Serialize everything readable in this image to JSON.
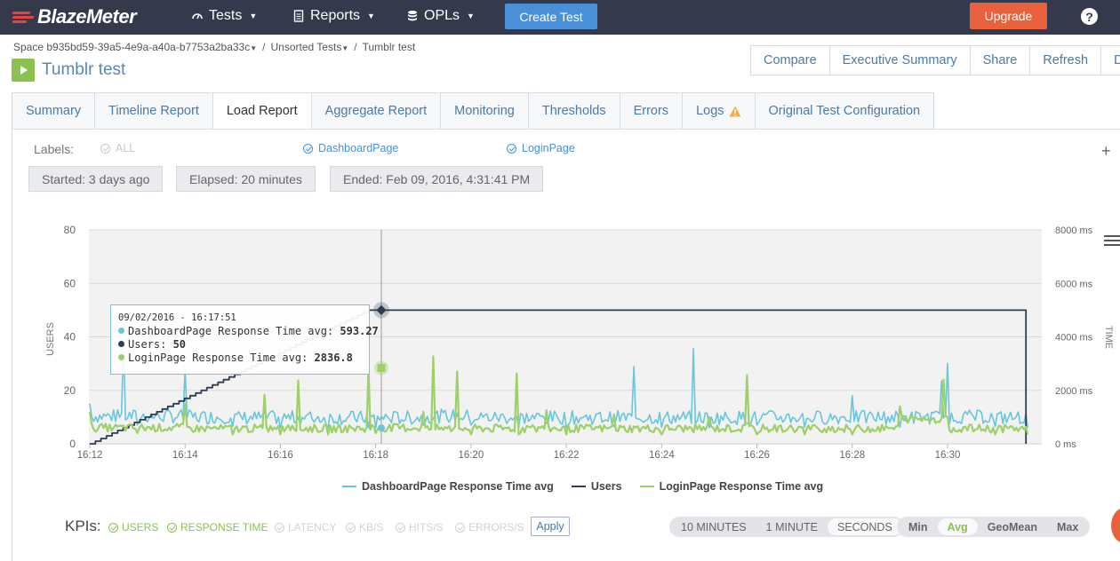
{
  "nav": {
    "brand": "BlazeMeter",
    "items": [
      {
        "label": "Tests",
        "icon": "gauge-icon"
      },
      {
        "label": "Reports",
        "icon": "document-icon"
      },
      {
        "label": "OPLs",
        "icon": "database-icon"
      }
    ],
    "create_label": "Create Test",
    "upgrade_label": "Upgrade",
    "help_label": "?"
  },
  "breadcrumb": {
    "space": "Space b935bd59-39a5-4e9a-a40a-b7753a2ba33c",
    "folder": "Unsorted Tests",
    "test": "Tumblr test",
    "separator": "/"
  },
  "page_title": "Tumblr test",
  "actions": [
    "Compare",
    "Executive Summary",
    "Share",
    "Refresh",
    "D"
  ],
  "tabs": [
    {
      "label": "Summary"
    },
    {
      "label": "Timeline Report"
    },
    {
      "label": "Load Report",
      "active": true
    },
    {
      "label": "Aggregate Report"
    },
    {
      "label": "Monitoring"
    },
    {
      "label": "Thresholds"
    },
    {
      "label": "Errors"
    },
    {
      "label": "Logs",
      "warning": true
    },
    {
      "label": "Original Test Configuration"
    }
  ],
  "labels": {
    "title": "Labels:",
    "options": [
      {
        "label": "ALL",
        "checked": false
      },
      {
        "label": "DashboardPage",
        "checked": true
      },
      {
        "label": "LoginPage",
        "checked": true
      }
    ]
  },
  "status": {
    "started": "Started: 3 days ago",
    "elapsed": "Elapsed: 20 minutes",
    "ended": "Ended: Feb 09, 2016, 4:31:41 PM"
  },
  "tooltip": {
    "timestamp": "09/02/2016 - 16:17:51",
    "rows": [
      {
        "label": "DashboardPage Response Time avg: ",
        "value": "593.27",
        "color": "#67c6dc"
      },
      {
        "label": "Users: ",
        "value": "50",
        "color": "#2d3e50"
      },
      {
        "label": "LoginPage Response Time avg: ",
        "value": "2836.8",
        "color": "#9ed068"
      }
    ]
  },
  "chart_data": {
    "type": "line",
    "x": [
      "16:12",
      "16:13",
      "16:14",
      "16:15",
      "16:16",
      "16:17",
      "16:17:51",
      "16:18",
      "16:19",
      "16:20",
      "16:21",
      "16:22",
      "16:23",
      "16:24",
      "16:25",
      "16:26",
      "16:27",
      "16:28",
      "16:29",
      "16:30",
      "16:31",
      "16:31:41"
    ],
    "x_ticks": [
      "16:12",
      "16:14",
      "16:16",
      "16:18",
      "16:20",
      "16:22",
      "16:24",
      "16:26",
      "16:28",
      "16:30"
    ],
    "y_left": {
      "label": "USERS",
      "ticks": [
        "0",
        "20",
        "40",
        "60",
        "80"
      ],
      "range": [
        0,
        80
      ]
    },
    "y_right": {
      "label": "TIME",
      "ticks": [
        "0 ms",
        "2000 ms",
        "4000 ms",
        "6000 ms",
        "8000 ms"
      ],
      "range": [
        0,
        8000
      ]
    },
    "series": [
      {
        "name": "DashboardPage Response Time avg",
        "axis": "right",
        "color": "#67c6dc",
        "values": [
          1500,
          700,
          2800,
          650,
          600,
          600,
          593.27,
          600,
          700,
          700,
          620,
          600,
          650,
          620,
          600,
          700,
          620,
          1800,
          620,
          3000,
          650,
          600
        ]
      },
      {
        "name": "Users",
        "axis": "left",
        "color": "#2d3e50",
        "values": [
          0,
          4,
          12,
          22,
          32,
          41,
          50,
          50,
          50,
          50,
          50,
          50,
          50,
          50,
          50,
          50,
          50,
          50,
          50,
          50,
          50,
          0
        ]
      },
      {
        "name": "LoginPage Response Time avg",
        "axis": "right",
        "color": "#9ed068",
        "values": [
          1200,
          400,
          1500,
          350,
          350,
          350,
          2836.8,
          400,
          1200,
          350,
          350,
          350,
          1100,
          350,
          1000,
          350,
          350,
          350,
          1400,
          1000,
          350,
          350
        ]
      }
    ],
    "legend_position": "bottom"
  },
  "kpis": {
    "title": "KPIs:",
    "items": [
      {
        "label": "USERS",
        "checked": true
      },
      {
        "label": "RESPONSE TIME",
        "checked": true
      },
      {
        "label": "LATENCY",
        "checked": false
      },
      {
        "label": "KB/S",
        "checked": false
      },
      {
        "label": "HITS/S",
        "checked": false
      },
      {
        "label": "ERRORS/S",
        "checked": false
      }
    ],
    "apply_label": "Apply",
    "granularity": [
      "10 MINUTES",
      "1 MINUTE",
      "SECONDS"
    ],
    "granularity_selected": "SECONDS",
    "aggregation": [
      "Min",
      "Avg",
      "GeoMean",
      "Max"
    ],
    "aggregation_selected": "Avg"
  },
  "colors": {
    "accent": "#4a90d9",
    "upgrade": "#e8603c",
    "nav_bg": "#343a4b",
    "link": "#4a7aa8",
    "green": "#8cc152"
  }
}
